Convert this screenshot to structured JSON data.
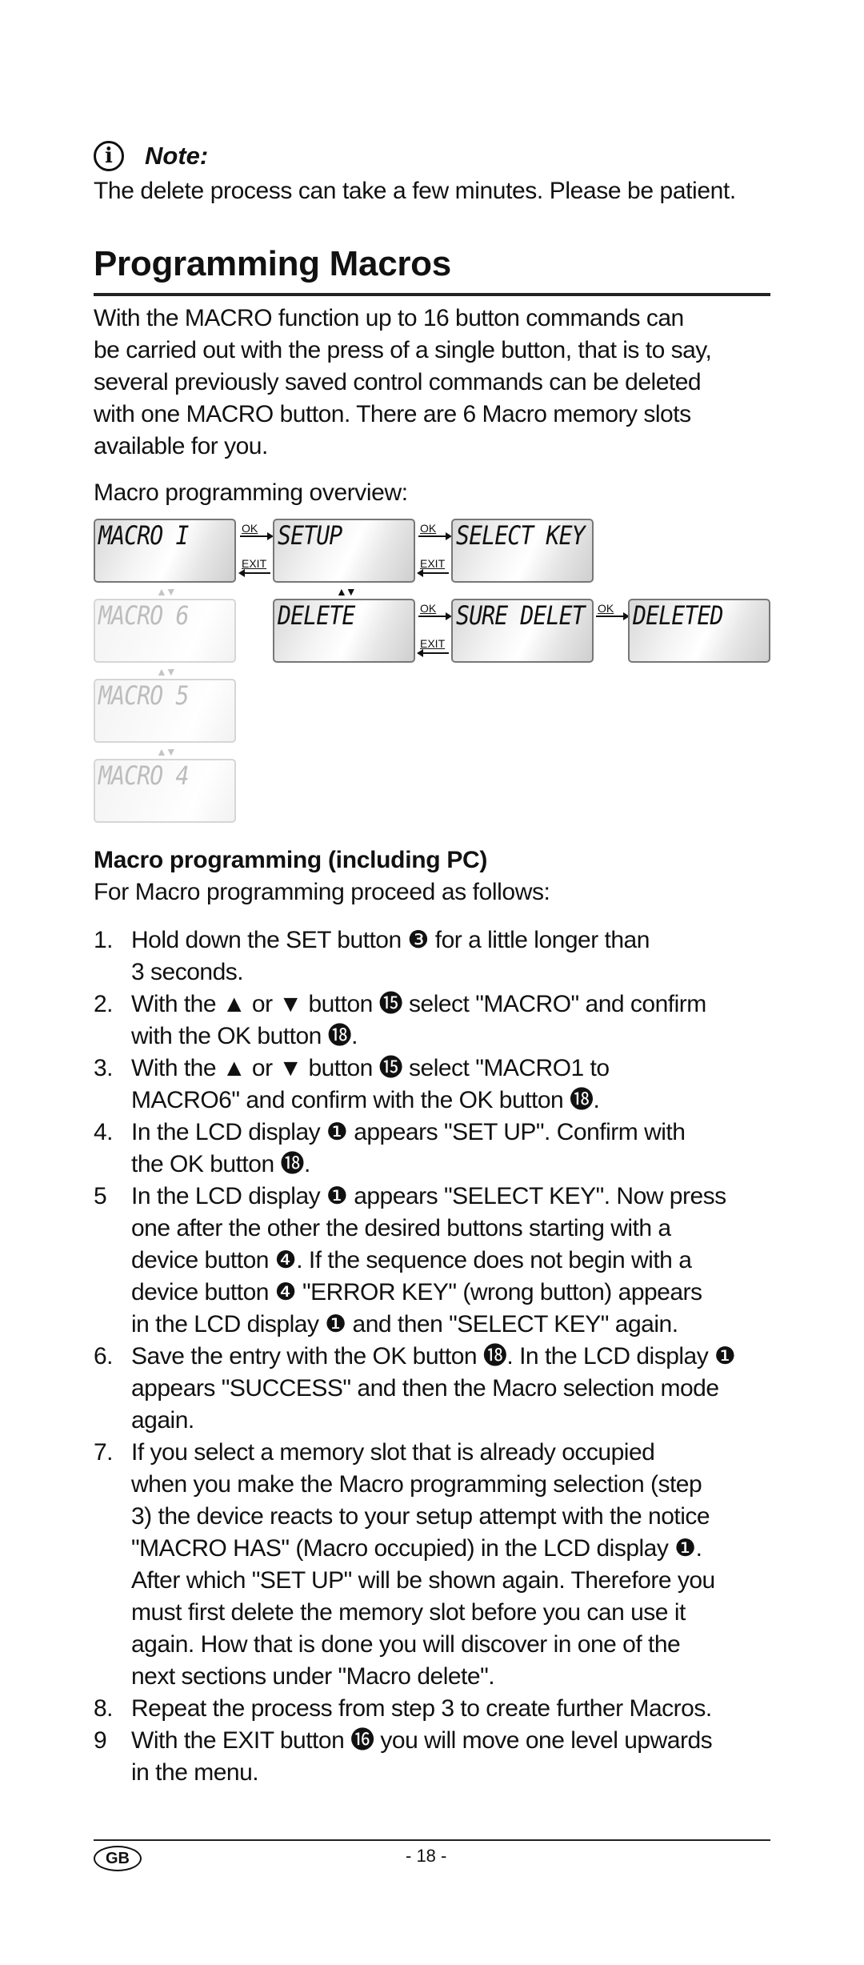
{
  "note": {
    "icon": "info-icon",
    "icon_glyph": "i",
    "title": "Note:",
    "text": "The delete process can take a few minutes. Please be patient."
  },
  "section": {
    "title": "Programming Macros",
    "paragraph_lines": [
      "With the MACRO function up to 16 button commands can",
      "be carried out with the press of a single button, that is to say,",
      "several previously saved control commands can be deleted",
      "with one MACRO button. There are 6 Macro memory slots",
      "available for you."
    ],
    "overview_label": "Macro programming overview:"
  },
  "diagram": {
    "screens": {
      "macro1": "MACRO I",
      "setup": "SETUP",
      "select_key": "SELECT KEY",
      "macro6": "MACRO 6",
      "delete": "DELETE",
      "sure_delet": "SURE DELET",
      "deleted": "DELETED",
      "macro5": "MACRO 5",
      "macro4": "MACRO 4"
    },
    "ok_label": "OK",
    "exit_label": "EXIT",
    "updown_glyph": "▲▼"
  },
  "subsection": {
    "title": "Macro programming (including PC)",
    "intro": "For Macro programming proceed as follows:",
    "steps": [
      {
        "num": "1.",
        "lines": [
          "Hold down the SET button ❸ for a little longer than",
          "3 seconds."
        ]
      },
      {
        "num": "2.",
        "lines": [
          "With the ▲ or ▼ button ⓯ select \"MACRO\" and confirm",
          "with the OK button ⓲."
        ]
      },
      {
        "num": "3.",
        "lines": [
          "With the ▲ or ▼ button ⓯ select \"MACRO1 to",
          "MACRO6\" and confirm with the OK button ⓲."
        ]
      },
      {
        "num": "4.",
        "lines": [
          "In the LCD display ❶ appears \"SET UP\". Confirm with",
          "the OK button ⓲."
        ]
      },
      {
        "num": "5",
        "lines": [
          "In the LCD display ❶ appears \"SELECT KEY\". Now press",
          "one after the other the desired buttons starting with a",
          "device button ❹. If the sequence does not begin with a",
          "device button ❹ \"ERROR KEY\" (wrong button) appears",
          "in the LCD display ❶ and then \"SELECT KEY\" again."
        ]
      },
      {
        "num": "6.",
        "lines": [
          "Save the entry with the OK button ⓲. In the LCD display ❶",
          "appears \"SUCCESS\" and then the Macro selection mode",
          "again."
        ]
      },
      {
        "num": "7.",
        "lines": [
          "If you select a memory slot that is already occupied",
          "when you make the Macro programming selection (step",
          "3) the device reacts to your setup attempt with the notice",
          "\"MACRO HAS\" (Macro occupied) in the LCD display ❶.",
          "After which \"SET UP\" will be shown again. Therefore you",
          "must first delete the memory slot before you can use it",
          "again. How that is done you will discover in one of the",
          "next sections under \"Macro delete\"."
        ]
      },
      {
        "num": "8.",
        "lines": [
          "Repeat the process from step 3 to create further Macros."
        ]
      },
      {
        "num": "9",
        "lines": [
          "With the EXIT button ⓰ you will move one level upwards",
          "in the menu."
        ]
      }
    ]
  },
  "footer": {
    "country_badge": "GB",
    "page_number": "- 18 -"
  }
}
